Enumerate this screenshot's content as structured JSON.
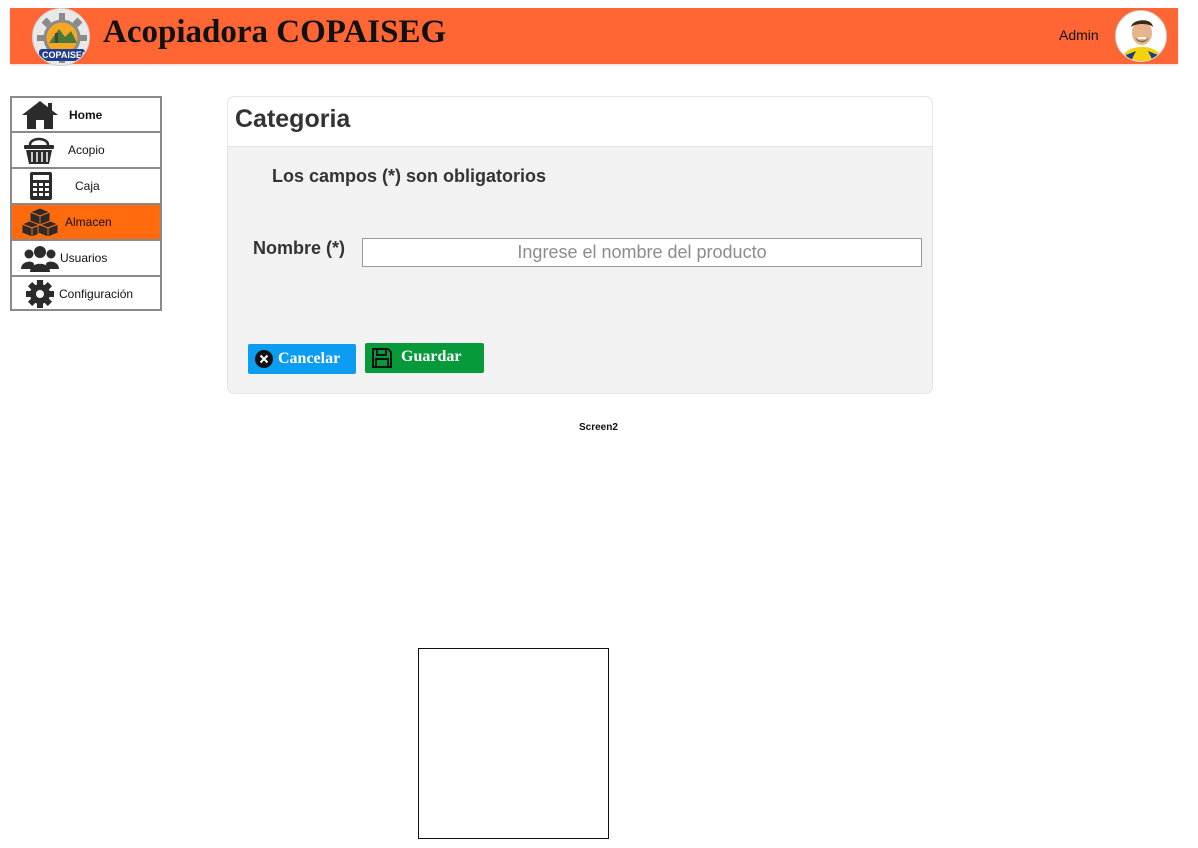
{
  "header": {
    "app_title": "Acopiadora COPAISEG",
    "logo_text": "COPAISEG",
    "logo_icon": "gear-logo",
    "user_label": "Admin",
    "avatar_icon": "user-avatar",
    "background_color": "#ff6633"
  },
  "sidebar": {
    "items": [
      {
        "label": "Home",
        "icon": "home-icon",
        "active": false
      },
      {
        "label": "Acopio",
        "icon": "basket-icon",
        "active": false
      },
      {
        "label": "Caja",
        "icon": "calculator-icon",
        "active": false
      },
      {
        "label": "Almacen",
        "icon": "boxes-icon",
        "active": true
      },
      {
        "label": "Usuarios",
        "icon": "users-icon",
        "active": false
      },
      {
        "label": "Configuración",
        "icon": "gear-icon",
        "active": false
      }
    ],
    "active_color": "#ff6a0d"
  },
  "form": {
    "title": "Categoria",
    "required_note": "Los campos (*) son obligatorios",
    "name_label": "Nombre (*)",
    "name_value": "",
    "name_placeholder": "Ingrese el nombre del producto",
    "cancel_label": "Cancelar",
    "cancel_icon": "close-circle-icon",
    "cancel_color": "#0c9cf2",
    "save_label": "Guardar",
    "save_icon": "floppy-disk-icon",
    "save_color": "#079a3a"
  },
  "caption": "Screen2"
}
